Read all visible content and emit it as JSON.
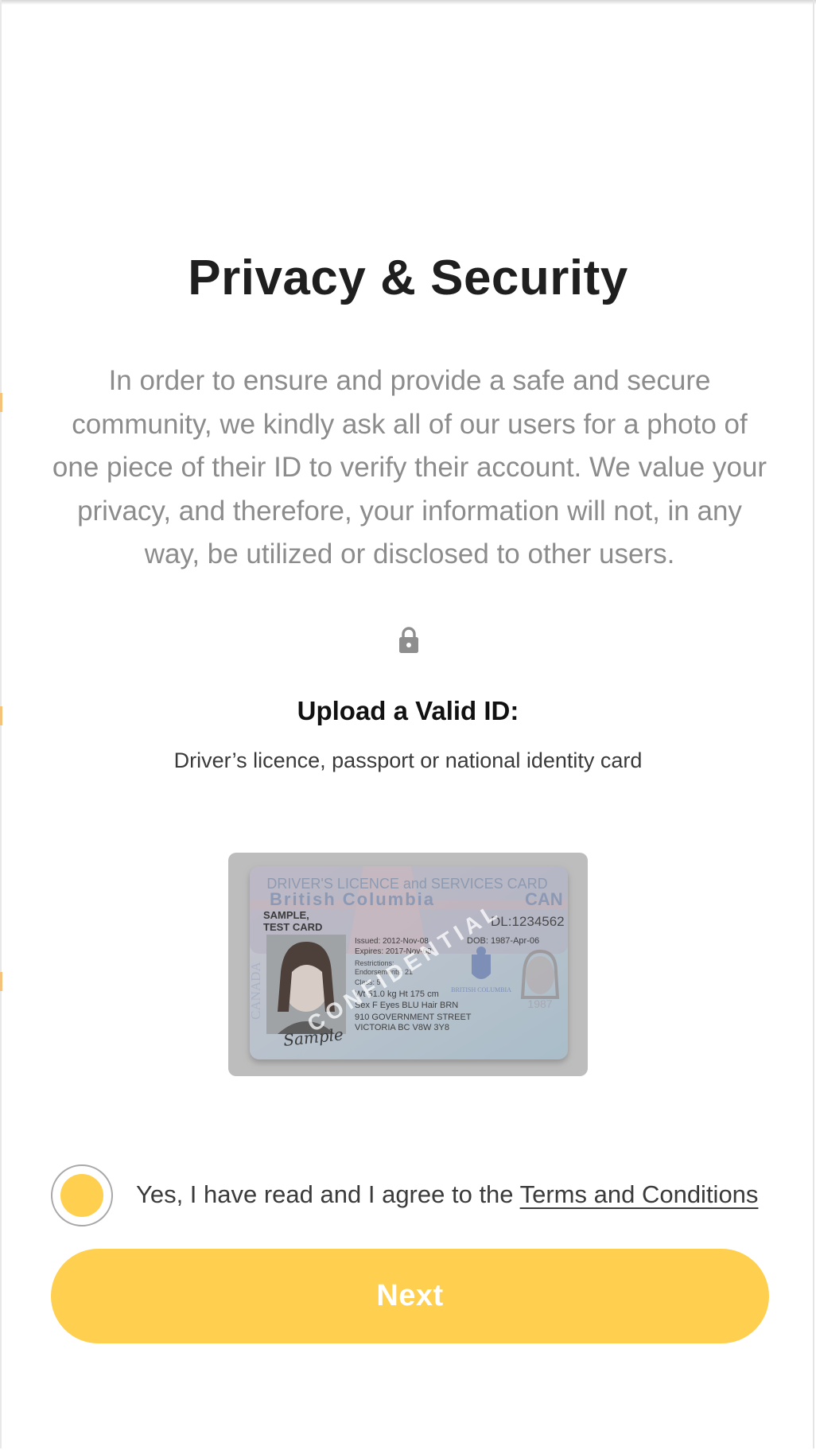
{
  "page": {
    "title": "Privacy & Security",
    "description": "In order to ensure and provide a safe and secure community, we kindly ask all of our users for a photo of one piece of their ID to verify their account. We value your privacy, and therefore, your information will not, in any way, be utilized or disclosed to other users."
  },
  "upload": {
    "icon": "lock-icon",
    "heading": "Upload a Valid ID:",
    "subtitle": "Driver’s licence, passport or national identity card",
    "sample_card": {
      "header": "DRIVER'S LICENCE and SERVICES CARD",
      "province": "British Columbia",
      "country_code": "CAN",
      "name_line1": "SAMPLE,",
      "name_line2": "TEST CARD",
      "dl_number": "DL:1234562",
      "issued": "Issued:  2012-Nov-08",
      "expires": "Expires: 2017-Nov-08",
      "dob": "DOB: 1987-Apr-06",
      "restrictions": "Restrictions:",
      "endorsements": "Endorsements: 21",
      "class": "Class: 5",
      "weight_height": "Wt 51.0 kg   Ht 175 cm",
      "sex_eyes_hair": "Sex F   Eyes BLU   Hair BRN",
      "address_line1": "910 GOVERNMENT STREET",
      "address_line2": "VICTORIA BC  V8W 3Y8",
      "vertical_text": "CANADA",
      "crest_label": "BRITISH COLUMBIA",
      "ghost_year": "1987",
      "watermark": "CONFIDENTIAL",
      "signature": "Sample"
    }
  },
  "terms": {
    "checked": true,
    "prefix": "Yes, I have read and I agree to the",
    "link_label": "Terms and Conditions"
  },
  "actions": {
    "next_label": "Next"
  },
  "colors": {
    "accent": "#ffcf4f",
    "title": "#1f1f1f",
    "description": "#8c8c8c",
    "card_frame": "#bdbdbd"
  }
}
